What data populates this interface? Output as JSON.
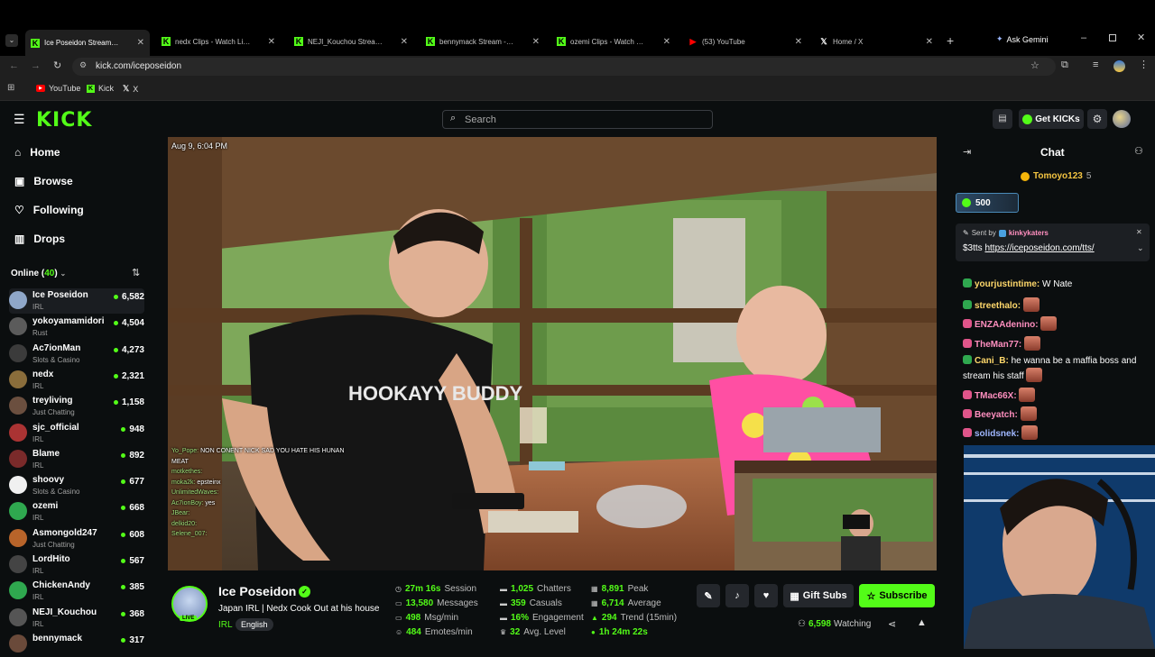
{
  "browser": {
    "tabs": [
      {
        "title": "Ice Poseidon Stream - W",
        "icon": "kick-icon",
        "color": "#53fc18"
      },
      {
        "title": "nedx Clips - Watch Live on",
        "icon": "kick-icon",
        "color": "#53fc18"
      },
      {
        "title": "NEJI_Kouchou Stream - Wat",
        "icon": "kick-icon",
        "color": "#53fc18"
      },
      {
        "title": "bennymack Stream - Watch",
        "icon": "kick-icon",
        "color": "#53fc18"
      },
      {
        "title": "ozemi Clips - Watch Live on",
        "icon": "kick-icon",
        "color": "#53fc18"
      },
      {
        "title": "(53) YouTube",
        "icon": "youtube-icon",
        "color": "#ff0000"
      },
      {
        "title": "Home / X",
        "icon": "x-icon",
        "color": "#ffffff"
      }
    ],
    "gemini_label": "Ask Gemini",
    "url": "kick.com/iceposeidon",
    "bookmarks": [
      "YouTube",
      "Kick",
      "X"
    ]
  },
  "header": {
    "logo": "KICK",
    "search_placeholder": "Search",
    "get_kicks_label": "Get KICKs"
  },
  "sidebar": {
    "nav": [
      {
        "label": "Home",
        "icon": "home-icon"
      },
      {
        "label": "Browse",
        "icon": "browse-icon"
      },
      {
        "label": "Following",
        "icon": "heart-icon"
      },
      {
        "label": "Drops",
        "icon": "drops-icon"
      }
    ],
    "online_label": "Online (",
    "online_count": "40",
    "online_close": ")",
    "channels": [
      {
        "name": "Ice Poseidon",
        "category": "IRL",
        "viewers": "6,582",
        "color": "#8fa7c9"
      },
      {
        "name": "yokoyamamidori",
        "category": "Rust",
        "viewers": "4,504",
        "color": "#5b5b5b"
      },
      {
        "name": "Ac7ionMan",
        "category": "Slots & Casino",
        "viewers": "4,273",
        "color": "#3b3b3b"
      },
      {
        "name": "nedx",
        "category": "IRL",
        "viewers": "2,321",
        "color": "#8a6d3b"
      },
      {
        "name": "treyliving",
        "category": "Just Chatting",
        "viewers": "1,158",
        "color": "#6b4f3f"
      },
      {
        "name": "sjc_official",
        "category": "IRL",
        "viewers": "948",
        "color": "#a33"
      },
      {
        "name": "Blame",
        "category": "IRL",
        "viewers": "892",
        "color": "#7a2a2a"
      },
      {
        "name": "shoovy",
        "category": "Slots & Casino",
        "viewers": "677",
        "color": "#f0f0f0"
      },
      {
        "name": "ozemi",
        "category": "IRL",
        "viewers": "668",
        "color": "#2fa84f"
      },
      {
        "name": "Asmongold247",
        "category": "Just Chatting",
        "viewers": "608",
        "color": "#b8642a"
      },
      {
        "name": "LordHito",
        "category": "IRL",
        "viewers": "567",
        "color": "#444"
      },
      {
        "name": "ChickenAndy",
        "category": "IRL",
        "viewers": "385",
        "color": "#2fa84f"
      },
      {
        "name": "NEJI_Kouchou",
        "category": "IRL",
        "viewers": "368",
        "color": "#555"
      },
      {
        "name": "bennymack",
        "category": "",
        "viewers": "317",
        "color": "#6a4a3a"
      }
    ]
  },
  "video": {
    "timestamp": "Aug 9, 6:04 PM",
    "shirt_text": "HOOKAYY BUDDY",
    "overlay_chat": [
      {
        "user": "Yo_Pope:",
        "text": "NON CONENT NICK SAD YOU HATE HIS HUNAN"
      },
      {
        "user": "",
        "text": "MEAT"
      },
      {
        "user": "motkethes:",
        "text": ""
      },
      {
        "user": "moka2k:",
        "text": "epsteinx"
      },
      {
        "user": "UnlimitedWaves:",
        "text": ""
      },
      {
        "user": "Ac7ionBoy:",
        "text": "yes"
      },
      {
        "user": "JBear:",
        "text": ""
      },
      {
        "user": "delkid20:",
        "text": ""
      },
      {
        "user": "Selene_007:",
        "text": ""
      }
    ]
  },
  "streamer": {
    "name": "Ice Poseidon",
    "title": "Japan IRL | Nedx Cook Out at his house",
    "category": "IRL",
    "tag": "English",
    "live_badge": "LIVE"
  },
  "stats": [
    {
      "value": "27m 16s",
      "label": "Session",
      "icon": "clock-icon"
    },
    {
      "value": "13,580",
      "label": "Messages",
      "icon": "message-icon"
    },
    {
      "value": "498",
      "label": "Msg/min",
      "icon": "message-icon"
    },
    {
      "value": "484",
      "label": "Emotes/min",
      "icon": "emote-icon"
    },
    {
      "value": "1,025",
      "label": "Chatters",
      "icon": "users-icon"
    },
    {
      "value": "359",
      "label": "Casuals",
      "icon": "users-icon"
    },
    {
      "value": "16%",
      "label": "Engagement",
      "icon": "users-icon"
    },
    {
      "value": "32",
      "label": "Avg. Level",
      "icon": "trophy-icon"
    },
    {
      "value": "8,891",
      "label": "Peak",
      "icon": "chart-icon"
    },
    {
      "value": "6,714",
      "label": "Average",
      "icon": "chart-icon"
    },
    {
      "value": "294",
      "label": "Trend (15min)",
      "icon": "trend-up-icon"
    },
    {
      "value": "1h 24m 22s",
      "label": "",
      "icon": "dot-icon"
    }
  ],
  "actions": {
    "gift_label": "Gift Subs",
    "subscribe_label": "Subscribe",
    "watching_count": "6,598",
    "watching_label": "Watching"
  },
  "chat": {
    "title": "Chat",
    "top_gifter": "Tomoyo123",
    "top_gifter_count": "5",
    "kicks_amount": "500",
    "pinned_sent_by": "Sent by",
    "pinned_user": "kinkykaters",
    "pinned_prefix": "$3tts",
    "pinned_link": "https://iceposeidon.com/tts/",
    "messages": [
      {
        "user": "yourjustintime:",
        "text": "W Nate",
        "color": "#ffd86b",
        "badge": "#2fa84f",
        "emote": false
      },
      {
        "user": "streethalo:",
        "text": "",
        "color": "#ffd86b",
        "badge": "#2fa84f",
        "emote": true
      },
      {
        "user": "ENZAAdenino:",
        "text": "",
        "color": "#ff8fbf",
        "badge": "#e0558a",
        "emote": true
      },
      {
        "user": "TheMan77:",
        "text": "",
        "color": "#ff8fbf",
        "badge": "#e0558a",
        "emote": true
      },
      {
        "user": "Cani_B:",
        "text": "he wanna be a maffia boss and stream his staff",
        "color": "#ffd86b",
        "badge": "#2fa84f",
        "emote": true
      },
      {
        "user": "TMac66X:",
        "text": "",
        "color": "#ff8fbf",
        "badge": "#e0558a",
        "emote": true
      },
      {
        "user": "Beeyatch:",
        "text": "",
        "color": "#ff8fbf",
        "badge": "#e0558a",
        "emote": true
      },
      {
        "user": "solidsnek:",
        "text": "",
        "color": "#9fb7ff",
        "badge": "#e0558a",
        "emote": true
      }
    ]
  },
  "colors": {
    "accent": "#53fc18",
    "bg": "#0b0e0f",
    "panel": "#24272c"
  }
}
